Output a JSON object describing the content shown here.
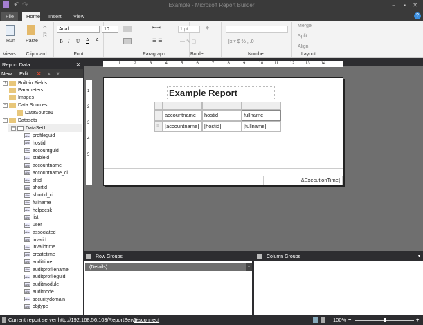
{
  "window": {
    "title": "Example - Microsoft Report Builder"
  },
  "tabs": [
    {
      "label": "File"
    },
    {
      "label": "Home"
    },
    {
      "label": "Insert"
    },
    {
      "label": "View"
    }
  ],
  "ribbon": {
    "groups": {
      "views": "Views",
      "clipboard": "Clipboard",
      "font": "Font",
      "paragraph": "Paragraph",
      "border": "Border",
      "number": "Number",
      "layout": "Layout"
    },
    "run": "Run",
    "paste": "Paste",
    "font_name": "Arial",
    "font_size": "10",
    "border_width": "1 pt",
    "merge": "Merge",
    "split": "Split",
    "align": "Align",
    "bold": "B",
    "italic": "I",
    "underline": "U",
    "font_color": "A",
    "grow": "A",
    "shrink": "A"
  },
  "report_data": {
    "title": "Report Data",
    "new": "New",
    "edit": "Edit...",
    "tree": {
      "builtin": "Built-in Fields",
      "parameters": "Parameters",
      "images": "Images",
      "datasources": "Data Sources",
      "datasource1": "DataSource1",
      "datasets": "Datasets",
      "dataset1": "DataSet1"
    },
    "fields": [
      "profileguid",
      "hostid",
      "accountguid",
      "stableid",
      "accountname",
      "accountname_ci",
      "altid",
      "shortid",
      "shortid_ci",
      "fullname",
      "helpdesk",
      "list",
      "user",
      "associated",
      "invalid",
      "invalidtime",
      "createtime",
      "audittime",
      "auditprofilename",
      "auditprofileguid",
      "auditmodule",
      "auditnode",
      "securitydomain",
      "objtype"
    ]
  },
  "ruler": [
    "1",
    "2",
    "3",
    "4",
    "5",
    "6",
    "7",
    "8",
    "9",
    "10",
    "11",
    "12",
    "13",
    "14"
  ],
  "vruler": [
    "1",
    "2",
    "3",
    "4",
    "5"
  ],
  "report": {
    "title": "Example Report",
    "headers": [
      "accountname",
      "hostid",
      "fullname"
    ],
    "values": [
      "[accountname]",
      "[hostid]",
      "[fullname]"
    ],
    "footer": "[&ExecutionTime]"
  },
  "groups": {
    "row_title": "Row Groups",
    "col_title": "Column Groups",
    "row_item": "(Details)"
  },
  "status": {
    "text": "Current report server http://192.168.56.103/ReportServer",
    "disconnect": "Disconnect",
    "zoom": "100%"
  }
}
